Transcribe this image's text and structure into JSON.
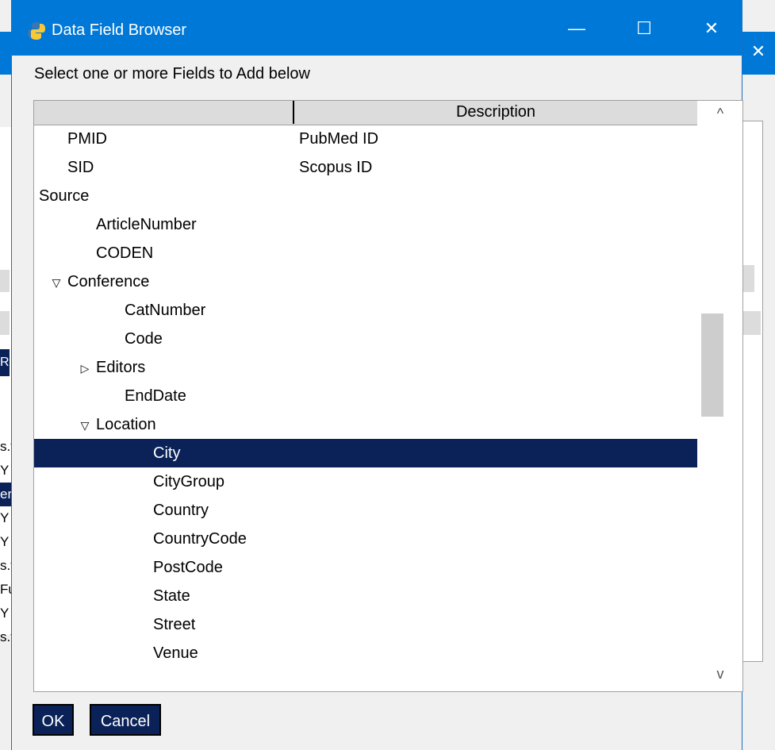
{
  "background": {
    "list_fragments": [
      "s.t",
      "Y",
      "er",
      "Y",
      "Y",
      "s.t",
      "Fu",
      "Y",
      "s.t"
    ],
    "left_button_fragment": "R"
  },
  "dialog": {
    "title": "Data Field Browser",
    "prompt": "Select one or more Fields to Add below",
    "columns": [
      "",
      "Description"
    ],
    "rows": [
      {
        "name": "PMID",
        "description": "PubMed ID",
        "level": 1,
        "expander": ""
      },
      {
        "name": "SID",
        "description": "Scopus ID",
        "level": 1,
        "expander": ""
      },
      {
        "name": "Source",
        "description": "",
        "level": 0,
        "expander": "expanded"
      },
      {
        "name": "ArticleNumber",
        "description": "",
        "level": 2,
        "expander": ""
      },
      {
        "name": "CODEN",
        "description": "",
        "level": 2,
        "expander": ""
      },
      {
        "name": "Conference",
        "description": "",
        "level": 1,
        "expander": "expanded"
      },
      {
        "name": "CatNumber",
        "description": "",
        "level": 3,
        "expander": ""
      },
      {
        "name": "Code",
        "description": "",
        "level": 3,
        "expander": ""
      },
      {
        "name": "Editors",
        "description": "",
        "level": 2,
        "expander": "collapsed"
      },
      {
        "name": "EndDate",
        "description": "",
        "level": 3,
        "expander": ""
      },
      {
        "name": "Location",
        "description": "",
        "level": 2,
        "expander": "expanded"
      },
      {
        "name": "City",
        "description": "",
        "level": 4,
        "expander": "",
        "selected": true
      },
      {
        "name": "CityGroup",
        "description": "",
        "level": 4,
        "expander": ""
      },
      {
        "name": "Country",
        "description": "",
        "level": 4,
        "expander": ""
      },
      {
        "name": "CountryCode",
        "description": "",
        "level": 4,
        "expander": ""
      },
      {
        "name": "PostCode",
        "description": "",
        "level": 4,
        "expander": ""
      },
      {
        "name": "State",
        "description": "",
        "level": 4,
        "expander": ""
      },
      {
        "name": "Street",
        "description": "",
        "level": 4,
        "expander": ""
      },
      {
        "name": "Venue",
        "description": "",
        "level": 4,
        "expander": ""
      }
    ],
    "buttons": {
      "ok": "OK",
      "cancel": "Cancel"
    },
    "window_controls": {
      "minimize": "—",
      "maximize": "☐",
      "close": "✕"
    },
    "bg_close": "✕",
    "scroll_up": "^",
    "scroll_down": "v"
  },
  "colors": {
    "titlebar": "#0078d7",
    "selection": "#0a2258"
  },
  "icons": {
    "app": "python-icon",
    "expanded": "triangle-down-icon",
    "collapsed": "triangle-right-icon"
  }
}
